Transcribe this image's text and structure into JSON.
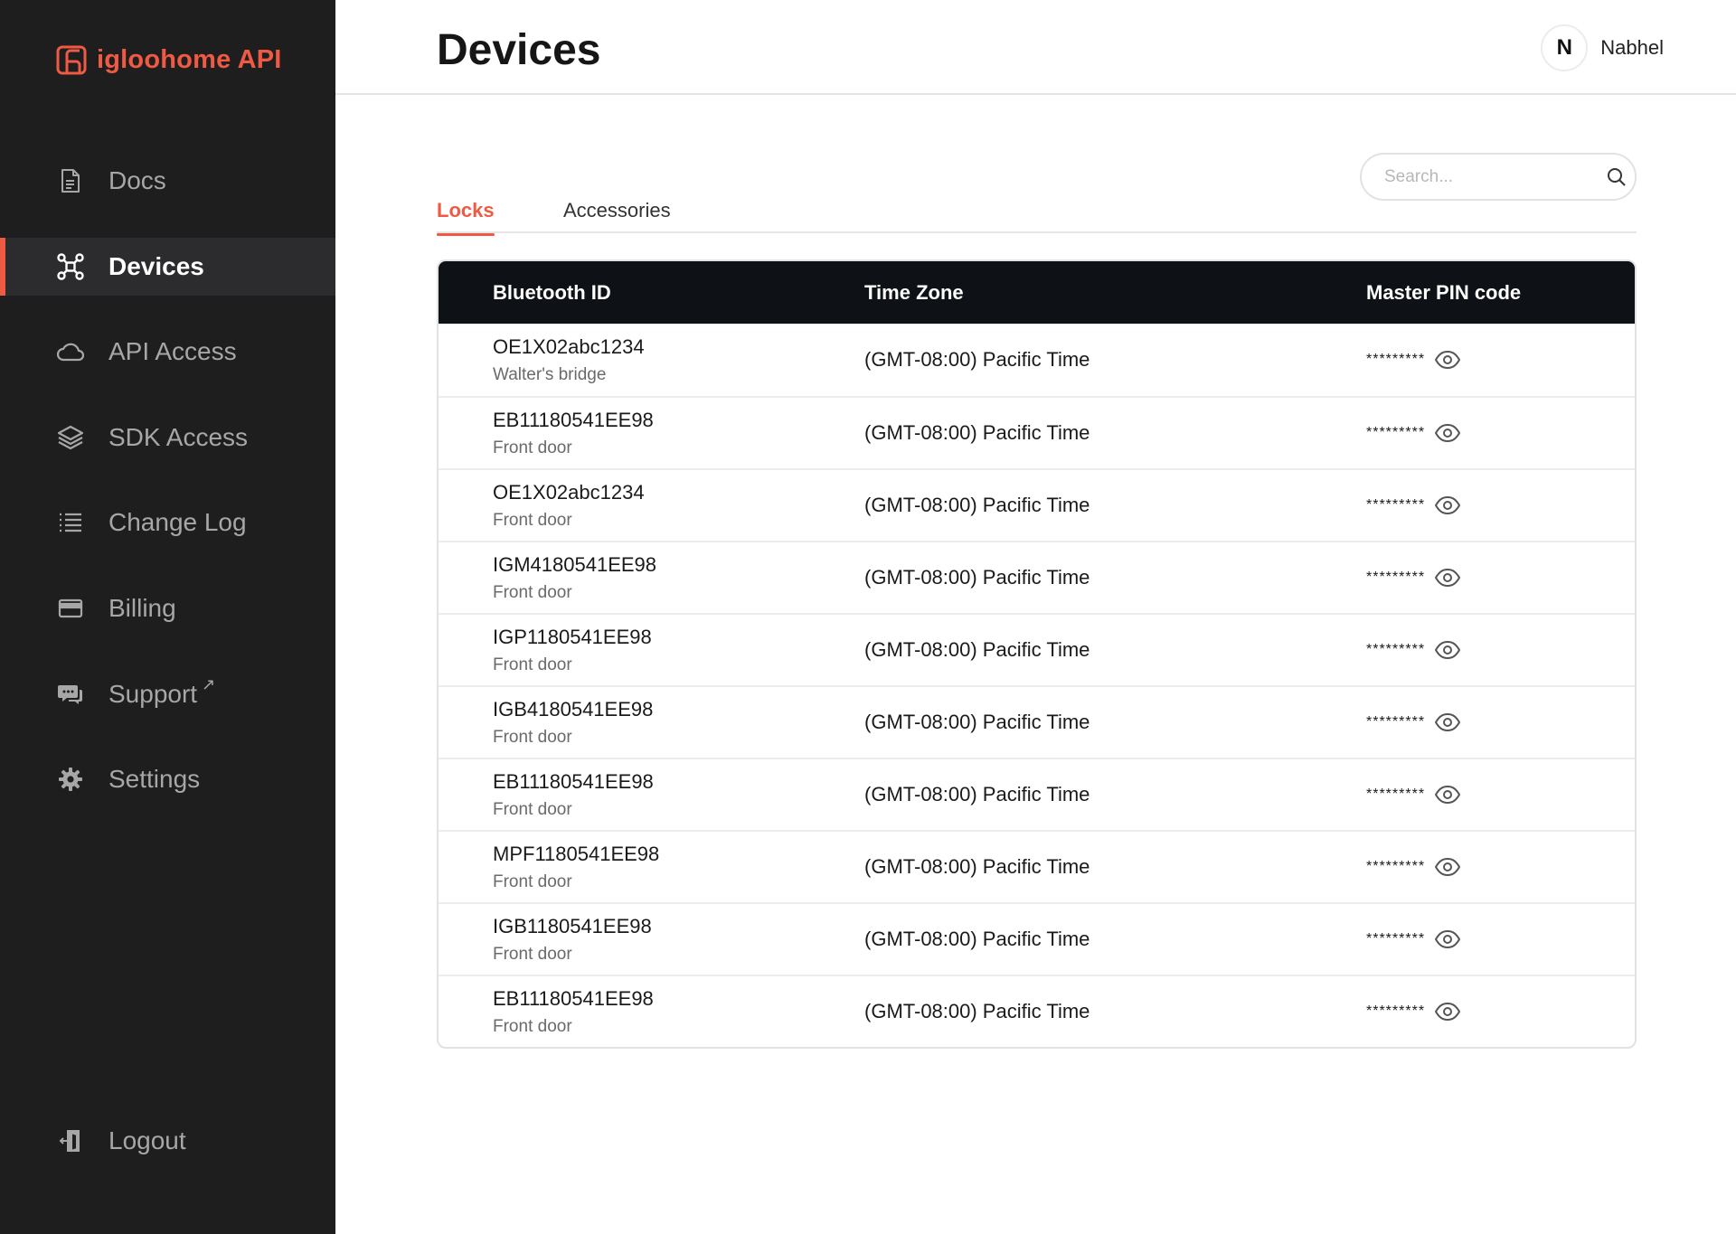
{
  "brand": {
    "name": "igloohome API",
    "accent": "#ee5a43"
  },
  "sidebar": {
    "items": [
      {
        "label": "Docs",
        "icon": "document-icon",
        "active": false
      },
      {
        "label": "Devices",
        "icon": "devices-network-icon",
        "active": true
      },
      {
        "label": "API Access",
        "icon": "cloud-icon",
        "active": false
      },
      {
        "label": "SDK Access",
        "icon": "layers-icon",
        "active": false
      },
      {
        "label": "Change Log",
        "icon": "list-icon",
        "active": false
      },
      {
        "label": "Billing",
        "icon": "credit-card-icon",
        "active": false
      },
      {
        "label": "Support",
        "icon": "chat-icon",
        "active": false,
        "external": true
      },
      {
        "label": "Settings",
        "icon": "gear-icon",
        "active": false
      }
    ],
    "logout": {
      "label": "Logout",
      "icon": "logout-icon"
    }
  },
  "header": {
    "title": "Devices",
    "user": {
      "initial": "N",
      "name": "Nabhel"
    }
  },
  "search": {
    "placeholder": "Search..."
  },
  "tabs": [
    {
      "label": "Locks",
      "active": true
    },
    {
      "label": "Accessories",
      "active": false
    }
  ],
  "table": {
    "columns": [
      "Bluetooth ID",
      "Time Zone",
      "Master PIN code"
    ],
    "rows": [
      {
        "id": "OE1X02abc1234",
        "name": "Walter's bridge",
        "timezone": "(GMT-08:00) Pacific Time",
        "pin": "*********"
      },
      {
        "id": "EB11180541EE98",
        "name": "Front door",
        "timezone": "(GMT-08:00) Pacific Time",
        "pin": "*********"
      },
      {
        "id": "OE1X02abc1234",
        "name": "Front door",
        "timezone": "(GMT-08:00) Pacific Time",
        "pin": "*********"
      },
      {
        "id": "IGM4180541EE98",
        "name": "Front door",
        "timezone": "(GMT-08:00) Pacific Time",
        "pin": "*********"
      },
      {
        "id": "IGP1180541EE98",
        "name": "Front door",
        "timezone": "(GMT-08:00) Pacific Time",
        "pin": "*********"
      },
      {
        "id": "IGB4180541EE98",
        "name": "Front door",
        "timezone": "(GMT-08:00) Pacific Time",
        "pin": "*********"
      },
      {
        "id": "EB11180541EE98",
        "name": "Front door",
        "timezone": "(GMT-08:00) Pacific Time",
        "pin": "*********"
      },
      {
        "id": "MPF1180541EE98",
        "name": "Front door",
        "timezone": "(GMT-08:00) Pacific Time",
        "pin": "*********"
      },
      {
        "id": "IGB1180541EE98",
        "name": "Front door",
        "timezone": "(GMT-08:00) Pacific Time",
        "pin": "*********"
      },
      {
        "id": "EB11180541EE98",
        "name": "Front door",
        "timezone": "(GMT-08:00) Pacific Time",
        "pin": "*********"
      }
    ]
  }
}
